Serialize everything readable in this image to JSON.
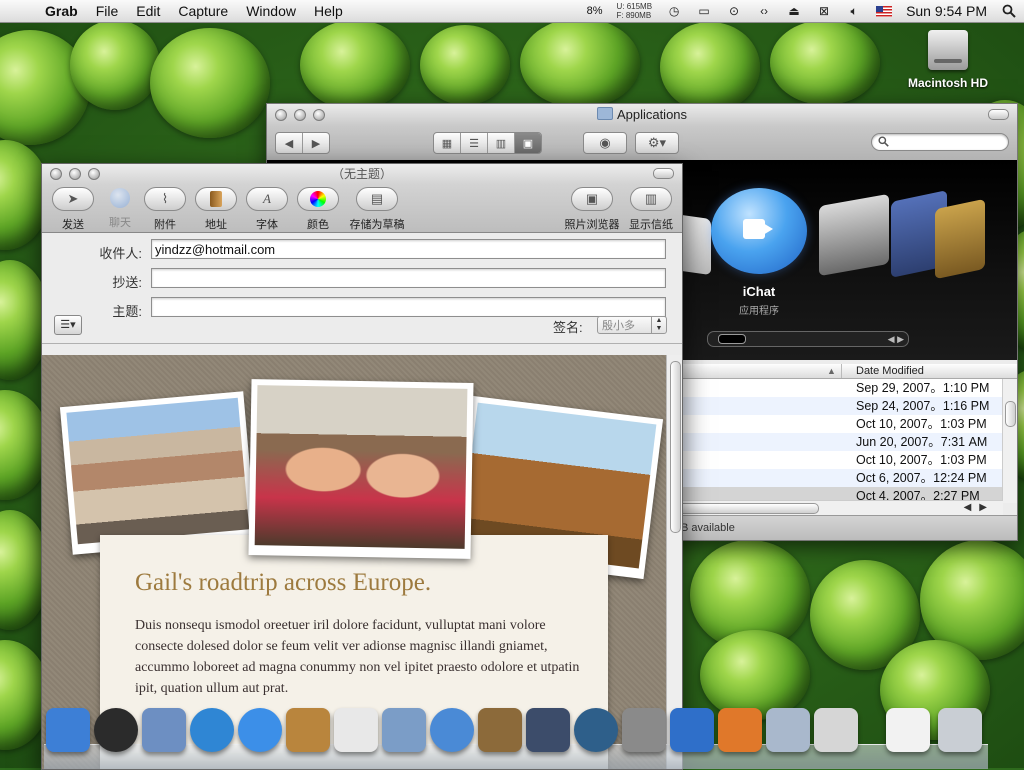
{
  "menubar": {
    "apple_glyph": "",
    "menus": [
      {
        "label": "Grab",
        "app": true
      },
      {
        "label": "File"
      },
      {
        "label": "Edit"
      },
      {
        "label": "Capture"
      },
      {
        "label": "Window"
      },
      {
        "label": "Help"
      }
    ],
    "cpu": "8%",
    "mem_used": "U:  615MB",
    "mem_free": "F:  890MB",
    "clock": "Sun 9:54 PM",
    "icons": [
      "spotlight-icon"
    ]
  },
  "desktop": {
    "hd_label": "Macintosh HD"
  },
  "finder": {
    "title": "Applications",
    "search_placeholder": "",
    "coverflow": {
      "selected_name": "iChat",
      "selected_kind": "应用程序"
    },
    "list": {
      "column_header": "Date Modified",
      "rows": [
        {
          "date": "Sep 29, 2007。1:10 PM",
          "selected": false
        },
        {
          "date": "Sep 24, 2007。1:16 PM",
          "selected": false
        },
        {
          "date": "Oct 10, 2007。1:03 PM",
          "selected": false
        },
        {
          "date": "Jun 20, 2007。7:31 AM",
          "selected": false
        },
        {
          "date": "Oct 10, 2007。1:03 PM",
          "selected": false
        },
        {
          "date": "Oct 6, 2007。12:24 PM",
          "selected": false
        },
        {
          "date": "Oct 4, 2007。2:27 PM",
          "selected": true
        }
      ]
    },
    "status_text": "B available"
  },
  "mail": {
    "title": "（无主题）",
    "toolbar": {
      "send": "发送",
      "chat": "聊天",
      "attach": "附件",
      "address": "地址",
      "fonts": "字体",
      "colors": "颜色",
      "save_draft": "存储为草稿",
      "photo_browser": "照片浏览器",
      "show_stationery": "显示信纸"
    },
    "fields": {
      "to_label": "收件人:",
      "to_value": "yindzz@hotmail.com",
      "cc_label": "抄送:",
      "cc_value": "",
      "subject_label": "主题:",
      "subject_value": ""
    },
    "signature_label": "签名:",
    "signature_value": "殷小多",
    "stationery": {
      "heading": "Gail's roadtrip across Europe.",
      "body": "Duis nonsequ ismodol oreetuer iril dolore facidunt, vulluptat mani volore consecte dolesed dolor se feum velit ver adionse magnisc illandi gniamet, accummo loboreet ad magna conummy non vel ipitet praesto odolore et utpatin ipit, quation ullum aut prat."
    }
  },
  "dock": {
    "items": [
      {
        "name": "finder-icon",
        "color": "#3d7fd6"
      },
      {
        "name": "dashboard-icon",
        "color": "#2b2b2b"
      },
      {
        "name": "mail-icon",
        "color": "#6d8fc2"
      },
      {
        "name": "safari-icon",
        "color": "#2f86d4"
      },
      {
        "name": "ichat-icon",
        "color": "#3c8fe8"
      },
      {
        "name": "address-book-icon",
        "color": "#b9853d"
      },
      {
        "name": "ical-icon",
        "color": "#e8e8e8"
      },
      {
        "name": "preview-icon",
        "color": "#7b9dc7"
      },
      {
        "name": "itunes-icon",
        "color": "#4a8ad6"
      },
      {
        "name": "iphoto-icon",
        "color": "#8c6a3a"
      },
      {
        "name": "spaces-icon",
        "color": "#3c4c6a"
      },
      {
        "name": "time-machine-icon",
        "color": "#2e5f8a"
      },
      {
        "name": "system-preferences-icon",
        "color": "#8a8a8a"
      },
      {
        "name": "word-icon",
        "color": "#2f6fc9"
      },
      {
        "name": "powerpoint-icon",
        "color": "#e0782a"
      },
      {
        "name": "applications-folder-icon",
        "color": "#a9b8cc"
      },
      {
        "name": "grab-icon",
        "color": "#d6d6d6"
      },
      {
        "name": "document-icon",
        "color": "#f2f2f2"
      },
      {
        "name": "trash-icon",
        "color": "#c9ced4"
      }
    ]
  }
}
